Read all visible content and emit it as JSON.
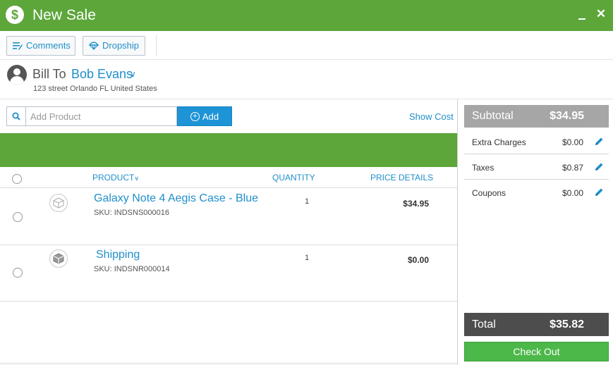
{
  "window": {
    "title": "New Sale",
    "minimize_label": "_",
    "close_label": "✕",
    "logo_glyph": "$"
  },
  "toolbar": {
    "comments_label": "Comments",
    "dropship_label": "Dropship"
  },
  "bill_to": {
    "label": "Bill To",
    "customer_name": "Bob Evans",
    "address": "123 street Orlando FL United States"
  },
  "product_search": {
    "placeholder": "Add Product",
    "value": "",
    "add_label": "Add",
    "show_cost_label": "Show Cost"
  },
  "table": {
    "headers": {
      "product": "PRODUCT",
      "quantity": "QUANTITY",
      "price_details": "PRICE DETAILS"
    },
    "rows": [
      {
        "name": "Galaxy Note 4 Aegis Case - Blue",
        "sku": "SKU:  INDSNS000016",
        "quantity": "1",
        "price": "$34.95",
        "icon": "box-icon"
      },
      {
        "name": "Shipping",
        "sku": "SKU:  INDSNR000014",
        "quantity": "1",
        "price": "$0.00",
        "icon": "shipping-box-icon"
      }
    ]
  },
  "summary": {
    "subtotal_label": "Subtotal",
    "subtotal_value": "$34.95",
    "charges": [
      {
        "label": "Extra Charges",
        "value": "$0.00"
      },
      {
        "label": "Taxes",
        "value": "$0.87"
      },
      {
        "label": "Coupons",
        "value": "$0.00"
      }
    ],
    "total_label": "Total",
    "total_value": "$35.82",
    "checkout_label": "Check Out"
  },
  "colors": {
    "brand_green": "#5ca63a",
    "link_blue": "#1f8fcb",
    "checkout_green": "#4cb84a"
  }
}
